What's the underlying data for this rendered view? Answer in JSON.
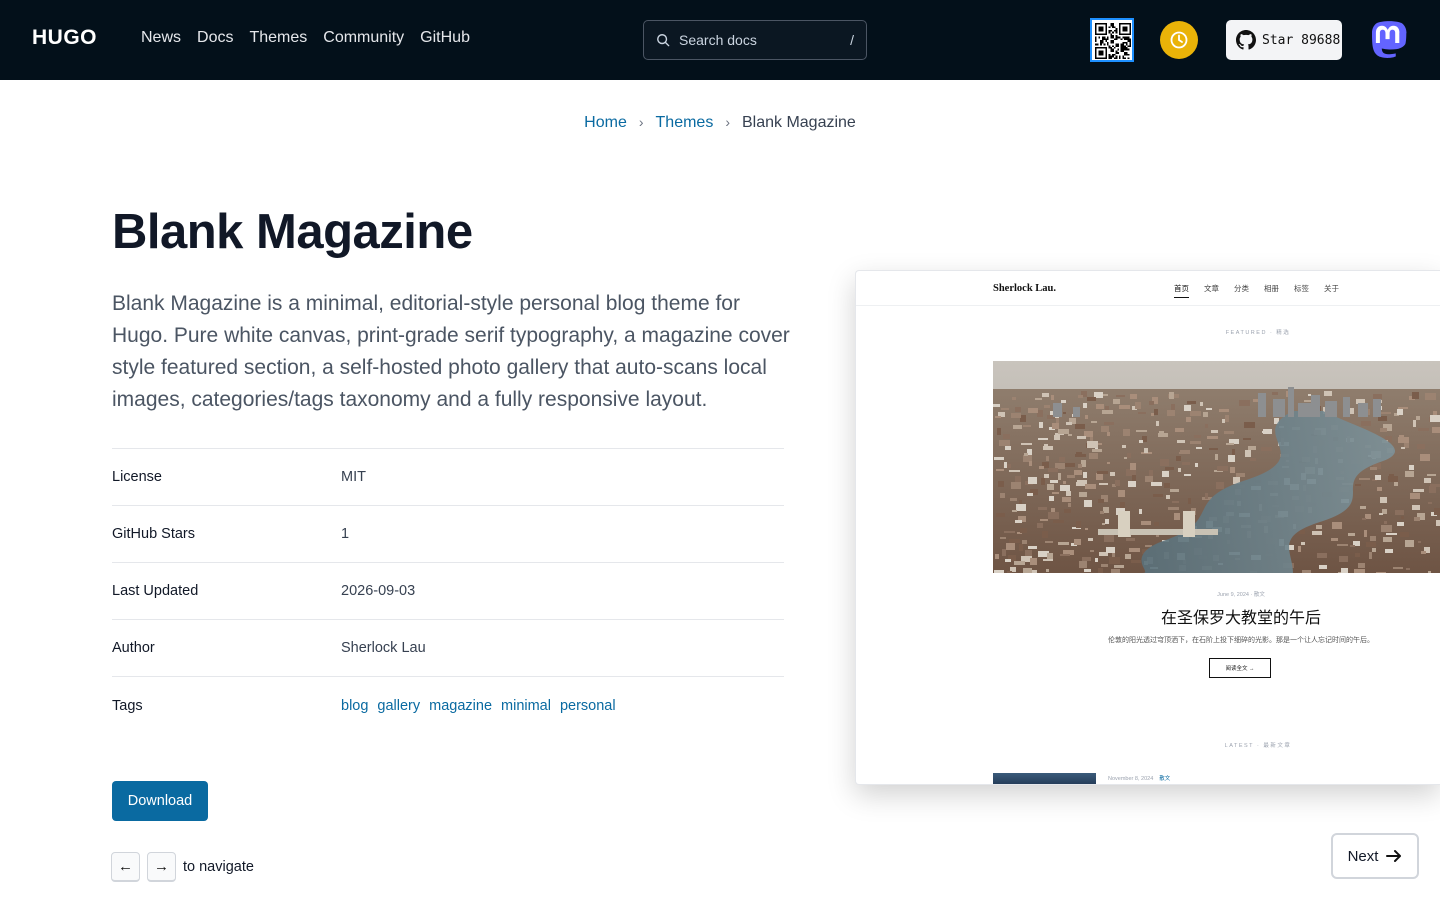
{
  "header": {
    "logo": "HUGO",
    "nav": [
      "News",
      "Docs",
      "Themes",
      "Community",
      "GitHub"
    ],
    "search": {
      "placeholder": "Search docs",
      "shortcut": "/"
    },
    "star_label": "Star 89688"
  },
  "breadcrumb": {
    "home": "Home",
    "themes": "Themes",
    "current": "Blank Magazine"
  },
  "theme": {
    "title": "Blank Magazine",
    "description": "Blank Magazine is a minimal, editorial-style personal blog theme for Hugo. Pure white canvas, print-grade serif typography, a magazine cover style featured section, a self-hosted photo gallery that auto-scans local images, categories/tags taxonomy and a fully responsive layout.",
    "meta": {
      "license_label": "License",
      "license": "MIT",
      "stars_label": "GitHub Stars",
      "stars": "1",
      "updated_label": "Last Updated",
      "updated": "2026-09-03",
      "author_label": "Author",
      "author": "Sherlock Lau",
      "tags_label": "Tags",
      "tags": [
        "blog",
        "gallery",
        "magazine",
        "minimal",
        "personal"
      ]
    },
    "download_label": "Download"
  },
  "pagination": {
    "prev_key": "←",
    "next_key": "→",
    "hint": "to navigate",
    "next_label": "Next"
  },
  "preview": {
    "brand": "Sherlock Lau.",
    "nav": [
      "首页",
      "文章",
      "分类",
      "相册",
      "标签",
      "关于"
    ],
    "featured_label": "FEATURED · 精选",
    "post_date": "June 9, 2024 · 散文",
    "post_title": "在圣保罗大教堂的午后",
    "post_excerpt": "伦敦的阳光透过穹顶洒下，在石阶上投下细碎的光影。那是一个让人忘记时间的午后。",
    "read_more": "阅读全文 →",
    "latest_label": "LATEST · 最新文章",
    "latest_date": "November 8, 2024",
    "latest_category": "散文"
  },
  "colors": {
    "header_bg": "#03101a",
    "link": "#0a6aa1",
    "download_bg": "#0a6aa1",
    "clock_bg": "#eab308",
    "mastodon": "#6364ff"
  }
}
